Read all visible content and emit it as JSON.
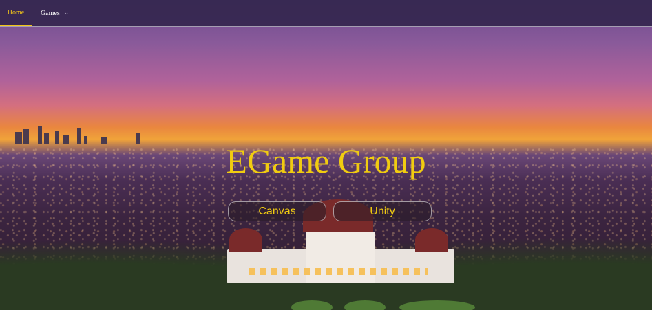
{
  "nav": {
    "home_label": "Home",
    "games_label": "Games",
    "games_chevron_icon": "chevron-down-icon",
    "active_color": "#f2c418"
  },
  "hero": {
    "title": "EGame Group",
    "buttons": [
      {
        "label": "Canvas"
      },
      {
        "label": "Unity"
      }
    ],
    "accent_color": "#f1cc10"
  }
}
